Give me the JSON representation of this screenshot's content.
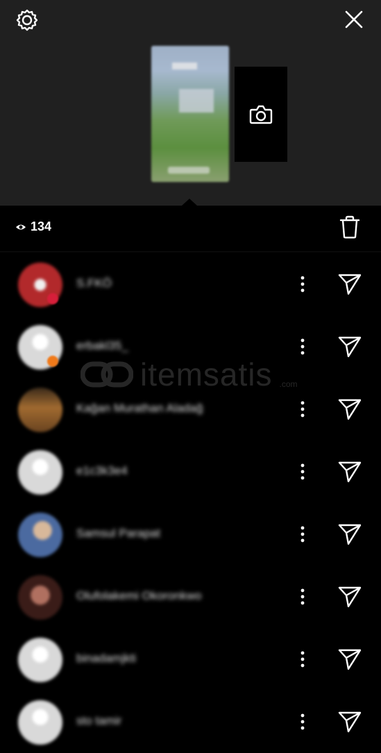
{
  "header": {
    "settings_icon": "gear-icon",
    "close_icon": "close-icon"
  },
  "story": {
    "camera_icon": "camera-icon"
  },
  "views": {
    "icon": "eye-icon",
    "count": "134",
    "delete_icon": "trash-icon"
  },
  "viewers": [
    {
      "name": "S.FKÖ",
      "avatar_color": "#b2292b"
    },
    {
      "name": "erbakl35_",
      "avatar_color": "default"
    },
    {
      "name": "Kağan Murathan Aladağ",
      "avatar_color": "#8a5a2a"
    },
    {
      "name": "e1c3k3e4",
      "avatar_color": "default"
    },
    {
      "name": "Samsul Parapat",
      "avatar_color": "#4b6aa0"
    },
    {
      "name": "Olufolakemi Okoronkwo",
      "avatar_color": "#6a3a2e"
    },
    {
      "name": "binadamjkti",
      "avatar_color": "default"
    },
    {
      "name": "sto tamir",
      "avatar_color": "default"
    }
  ],
  "watermark": {
    "text": "itemsatis",
    "tld": ".com"
  },
  "colors": {
    "top_background": "#202020",
    "list_background": "#000000",
    "text": "#ffffff"
  }
}
